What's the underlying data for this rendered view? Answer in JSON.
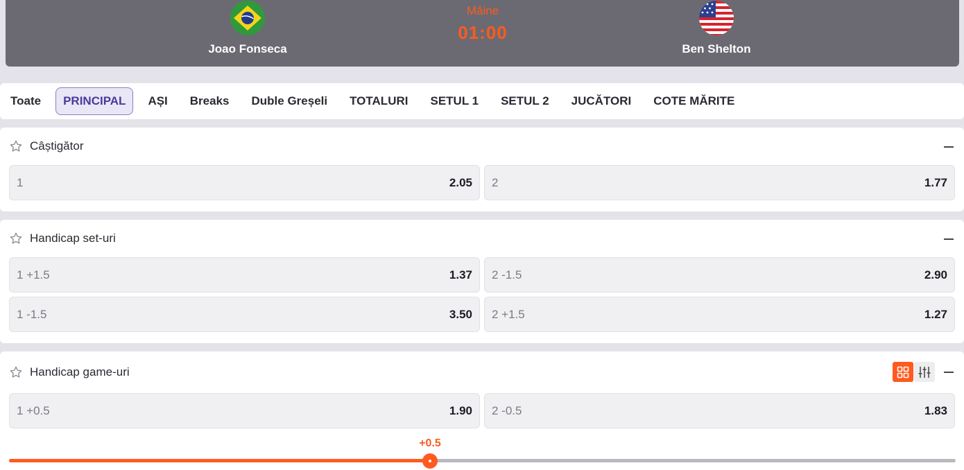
{
  "match": {
    "home": {
      "name": "Joao Fonseca",
      "flag": "brazil-flag-icon"
    },
    "away": {
      "name": "Ben Shelton",
      "flag": "usa-flag-icon"
    },
    "day": "Mâine",
    "time": "01:00",
    "accent": "#ff5a1f"
  },
  "tabs": [
    {
      "label": "Toate",
      "active": false
    },
    {
      "label": "PRINCIPAL",
      "active": true
    },
    {
      "label": "AȘI",
      "active": false
    },
    {
      "label": "Breaks",
      "active": false
    },
    {
      "label": "Duble Greșeli",
      "active": false
    },
    {
      "label": "TOTALURI",
      "active": false
    },
    {
      "label": "SETUL 1",
      "active": false
    },
    {
      "label": "SETUL 2",
      "active": false
    },
    {
      "label": "JUCĂTORI",
      "active": false
    },
    {
      "label": "COTE MĂRITE",
      "active": false
    }
  ],
  "markets": [
    {
      "title": "Câștigător",
      "rows": [
        [
          {
            "label": "1",
            "odds": "2.05"
          },
          {
            "label": "2",
            "odds": "1.77"
          }
        ]
      ]
    },
    {
      "title": "Handicap set-uri",
      "rows": [
        [
          {
            "label": "1 +1.5",
            "odds": "1.37"
          },
          {
            "label": "2 -1.5",
            "odds": "2.90"
          }
        ],
        [
          {
            "label": "1 -1.5",
            "odds": "3.50"
          },
          {
            "label": "2 +1.5",
            "odds": "1.27"
          }
        ]
      ]
    },
    {
      "title": "Handicap game-uri",
      "tools": [
        "grid-view-icon",
        "sliders-icon"
      ],
      "rows": [
        [
          {
            "label": "1 +0.5",
            "odds": "1.90"
          },
          {
            "label": "2 -0.5",
            "odds": "1.83"
          }
        ]
      ],
      "slider": {
        "value_label": "+0.5",
        "position_fraction": 0.445
      }
    }
  ]
}
